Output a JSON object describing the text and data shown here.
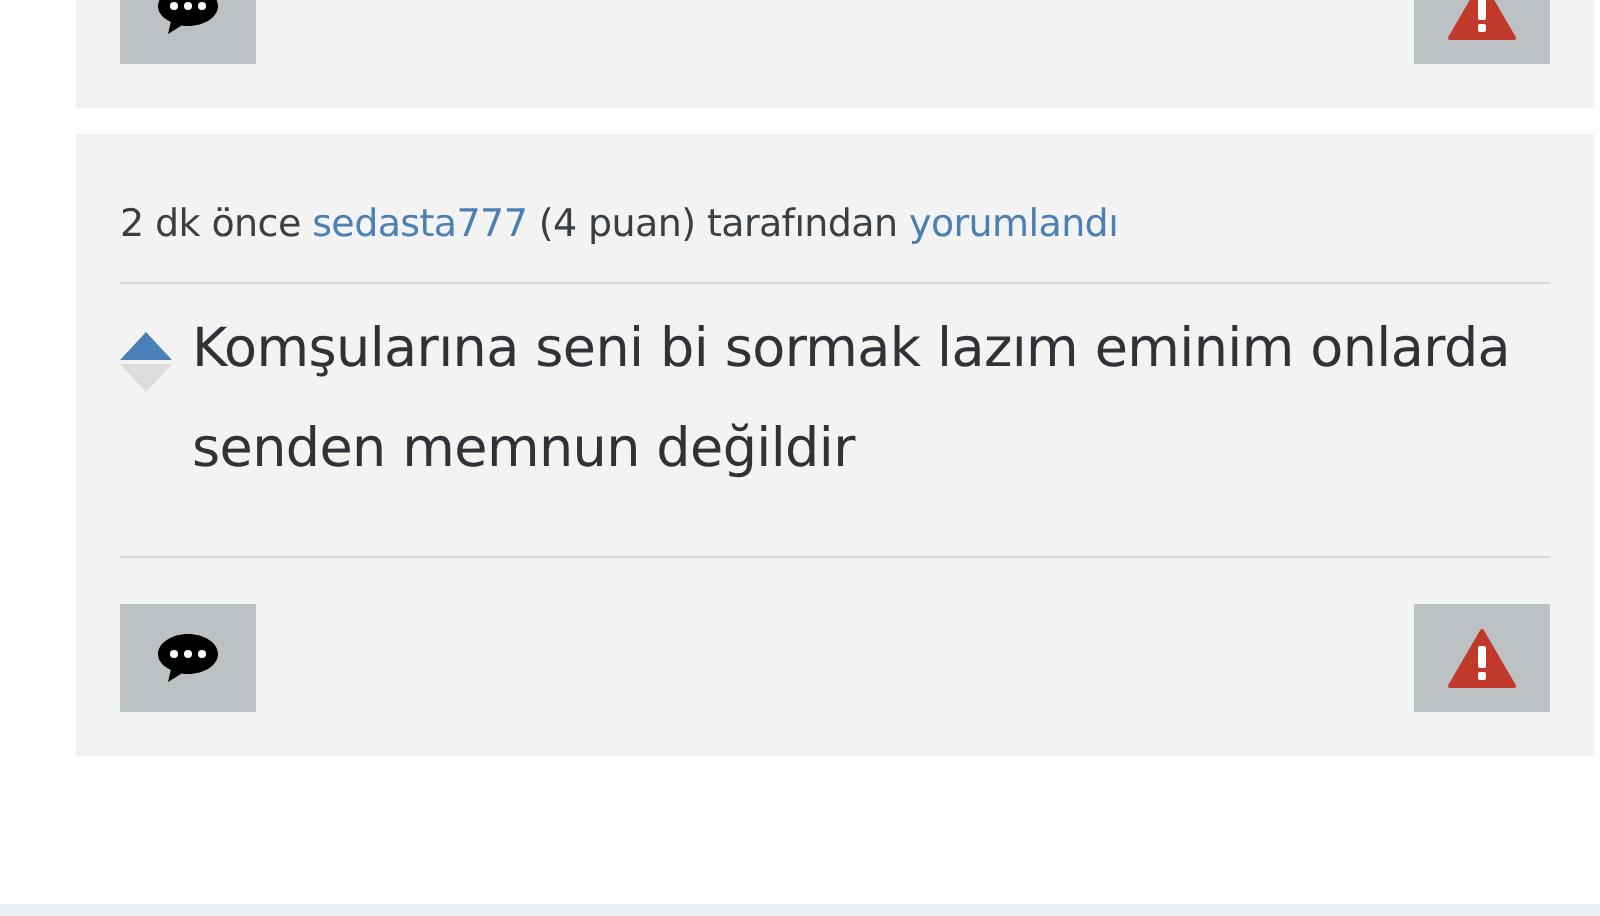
{
  "comments": [
    {
      "kind": "partial"
    },
    {
      "kind": "full",
      "time": "2 dk önce",
      "author": "sedasta777",
      "points": "(4 puan)",
      "by": "tarafından",
      "action": "yorumlandı",
      "text": "Komşularına seni bi sormak lazım eminim onlarda senden memnun değildir"
    }
  ]
}
